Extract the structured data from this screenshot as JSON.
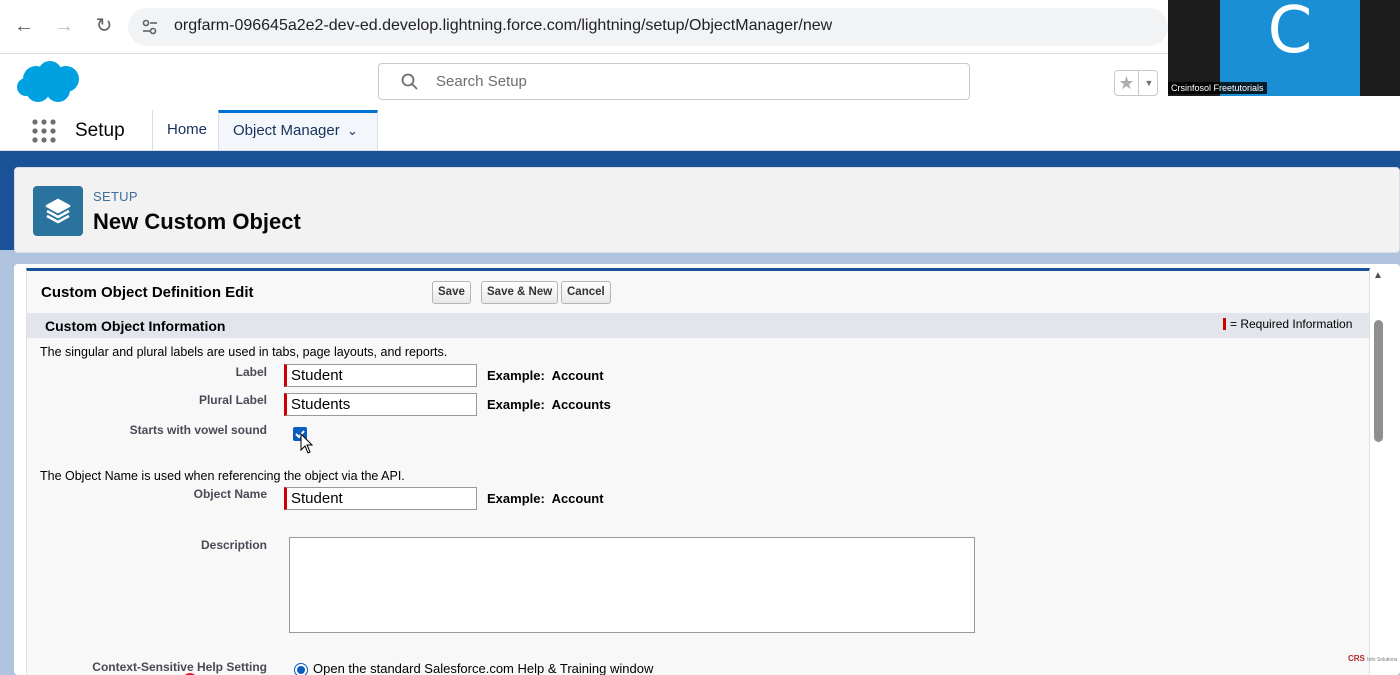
{
  "browser": {
    "url": "orgfarm-096645a2e2-dev-ed.develop.lightning.force.com/lightning/setup/ObjectManager/new"
  },
  "webcam": {
    "avatar_letter": "C",
    "participant_name": "Crsinfosol Freetutorials"
  },
  "header": {
    "search_placeholder": "Search Setup"
  },
  "appnav": {
    "app_name": "Setup",
    "tabs": [
      {
        "label": "Home"
      },
      {
        "label": "Object Manager"
      }
    ]
  },
  "page": {
    "eyebrow": "SETUP",
    "title": "New Custom Object"
  },
  "form": {
    "title": "Custom Object Definition Edit",
    "buttons": {
      "save": "Save",
      "save_new": "Save & New",
      "cancel": "Cancel"
    },
    "section_title": "Custom Object Information",
    "required_legend": "= Required Information",
    "labels_help": "The singular and plural labels are used in tabs, page layouts, and reports.",
    "fields": {
      "label": {
        "label": "Label",
        "value": "Student",
        "example_prefix": "Example:",
        "example_value": "Account"
      },
      "plural_label": {
        "label": "Plural Label",
        "value": "Students",
        "example_prefix": "Example:",
        "example_value": "Accounts"
      },
      "vowel": {
        "label": "Starts with vowel sound",
        "checked": true
      },
      "object_name": {
        "label": "Object Name",
        "value": "Student",
        "example_prefix": "Example:",
        "example_value": "Account"
      },
      "description": {
        "label": "Description",
        "value": ""
      },
      "help_setting": {
        "label": "Context-Sensitive Help Setting",
        "option": "Open the standard Salesforce.com Help & Training window"
      }
    },
    "api_help": "The Object Name is used when referencing the object via the API."
  },
  "watermark": {
    "brand": "CRS",
    "tagline": "Info Solutions"
  },
  "colors": {
    "accent": "#0070d2",
    "brand_blue": "#1b5297",
    "required_red": "#cc0000"
  }
}
